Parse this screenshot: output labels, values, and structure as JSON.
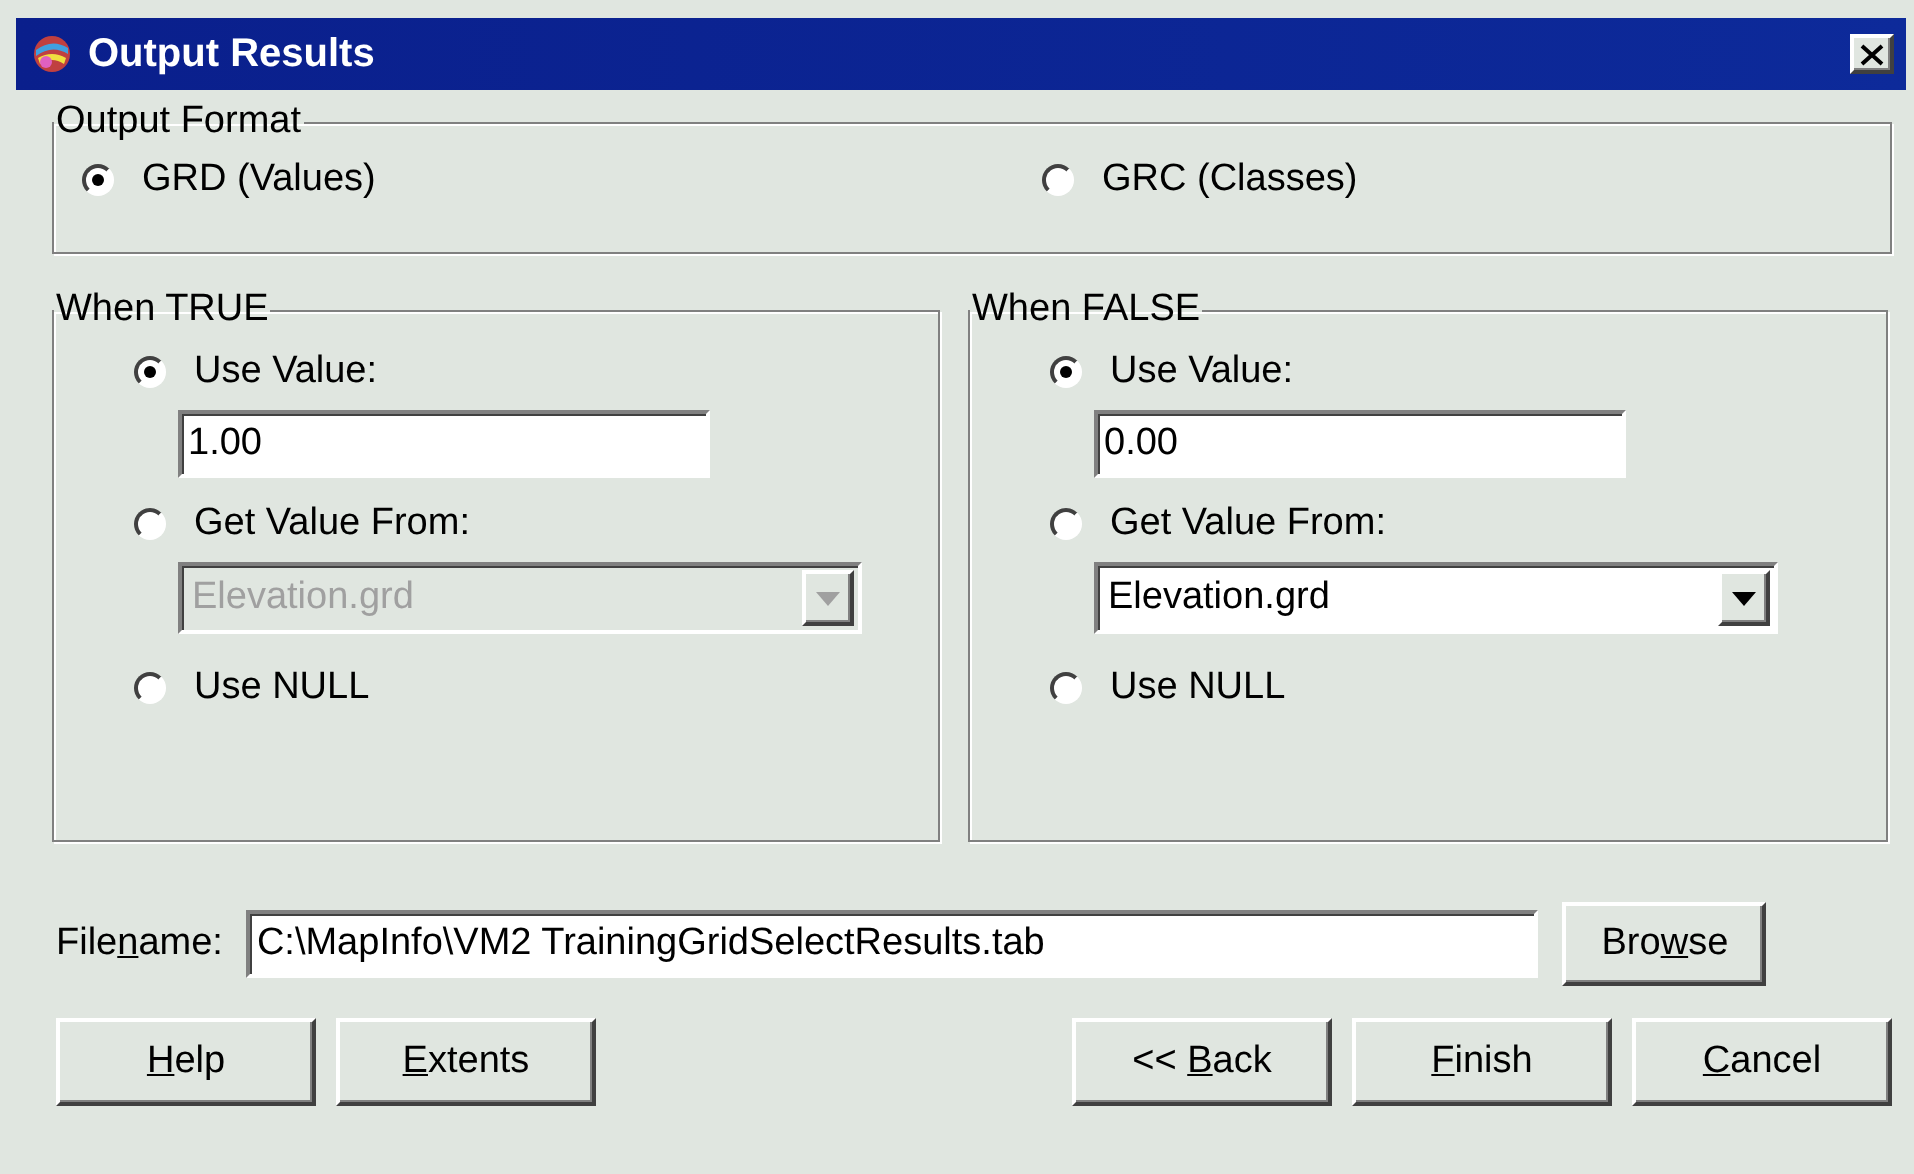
{
  "window": {
    "title": "Output Results"
  },
  "output_format": {
    "title": "Output Format",
    "options": [
      {
        "label": "GRD (Values)",
        "selected": true
      },
      {
        "label": "GRC (Classes)",
        "selected": false
      }
    ]
  },
  "groups": [
    {
      "title": "When TRUE",
      "options": [
        {
          "kind": "value",
          "label": "Use Value:",
          "selected": true,
          "value": "1.00"
        },
        {
          "kind": "combo",
          "label": "Get Value From:",
          "selected": false,
          "value": "Elevation.grd",
          "disabled": true
        },
        {
          "kind": "plain",
          "label": "Use NULL",
          "selected": false
        }
      ]
    },
    {
      "title": "When FALSE",
      "options": [
        {
          "kind": "value",
          "label": "Use Value:",
          "selected": true,
          "value": "0.00"
        },
        {
          "kind": "combo",
          "label": "Get Value From:",
          "selected": false,
          "value": "Elevation.grd",
          "disabled": false
        },
        {
          "kind": "plain",
          "label": "Use NULL",
          "selected": false
        }
      ]
    }
  ],
  "filename": {
    "label": {
      "pre": "File",
      "key": "n",
      "post": "ame:"
    },
    "value": "C:\\MapInfo\\VM2 TrainingGridSelectResults.tab",
    "button": {
      "pre": "Bro",
      "key": "w",
      "post": "se"
    }
  },
  "buttons_left": [
    {
      "key": "H",
      "post": "elp"
    },
    {
      "key": "E",
      "post": "xtents"
    }
  ],
  "buttons_right": [
    {
      "pre": "<< ",
      "key": "B",
      "post": "ack"
    },
    {
      "key": "F",
      "post": "inish"
    },
    {
      "key": "C",
      "post": "ancel"
    }
  ]
}
